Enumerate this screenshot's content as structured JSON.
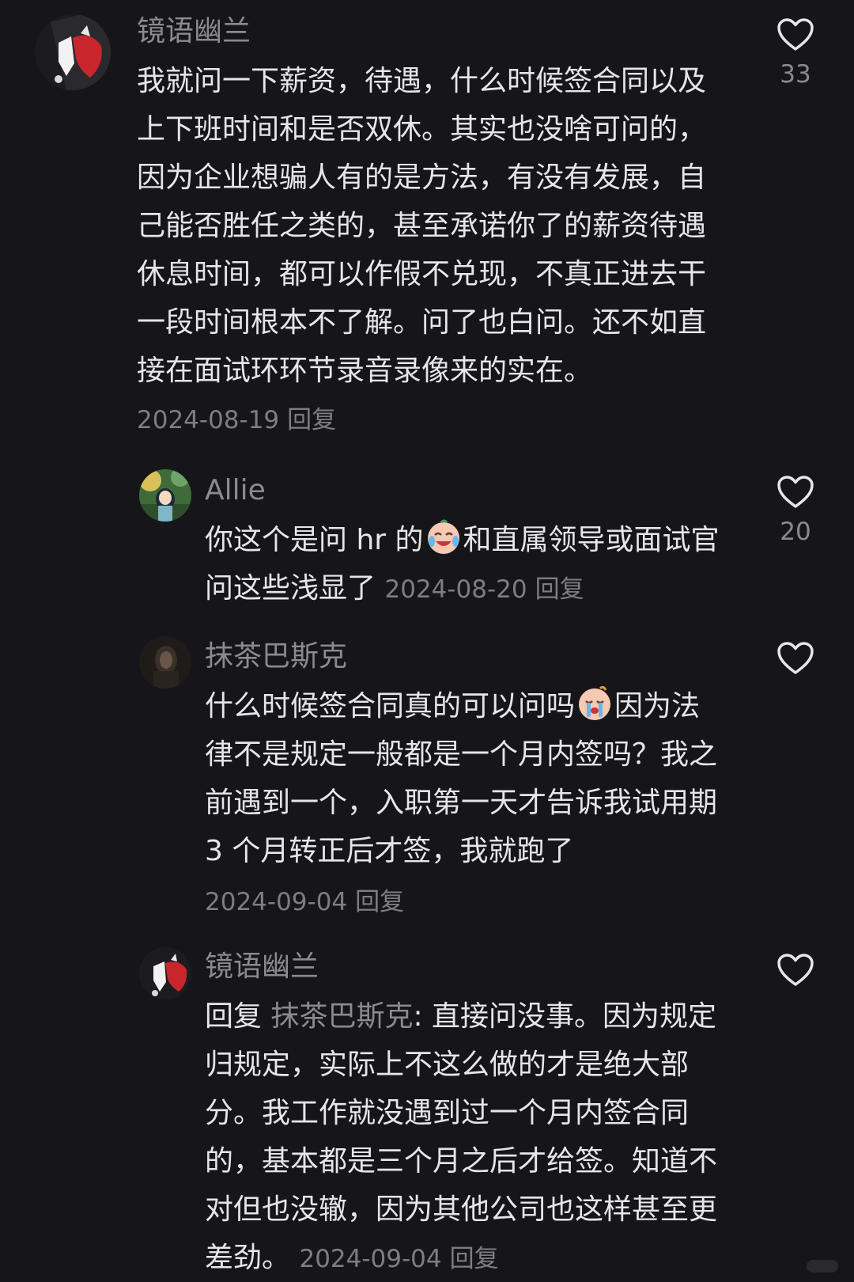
{
  "comments": [
    {
      "username": "镜语幽兰",
      "text": "我就问一下薪资，待遇，什么时候签合同以及上下班时间和是否双休。其实也没啥可问的，因为企业想骗人有的是方法，有没有发展，自己能否胜任之类的，甚至承诺你了的薪资待遇休息时间，都可以作假不兑现，不真正进去干一段时间根本不了解。问了也白问。还不如直接在面试环环节录音录像来的实在。",
      "date": "2024-08-19",
      "reply_label": "回复",
      "likes": "33"
    },
    {
      "username": "Allie",
      "text_before_emoji": "你这个是问 hr 的",
      "text_after_emoji": "和直属领导或面试官问这些浅显了",
      "emoji": "crying-laughing-face",
      "date": "2024-08-20",
      "reply_label": "回复",
      "likes": "20"
    },
    {
      "username": "抹茶巴斯克",
      "text_before_emoji": "什么时候签合同真的可以问吗",
      "text_after_emoji": "因为法律不是规定一般都是一个月内签吗？我之前遇到一个，入职第一天才告诉我试用期 3 个月转正后才签，我就跑了",
      "emoji": "crying-face",
      "date": "2024-09-04",
      "reply_label": "回复",
      "likes": ""
    },
    {
      "username": "镜语幽兰",
      "reply_prefix": "回复",
      "mention": "抹茶巴斯克",
      "text": ": 直接问没事。因为规定归规定，实际上不这么做的才是绝大部分。我工作就没遇到过一个月内签合同的，基本都是三个月之后才给签。知道不对但也没辙，因为其他公司也这样甚至更差劲。",
      "date": "2024-09-04",
      "reply_label": "回复",
      "likes": ""
    }
  ],
  "colors": {
    "background": "#16161a",
    "text": "#e6e6e8",
    "muted": "#8a8a8f"
  },
  "icons": {
    "like": "heart-outline-icon"
  }
}
